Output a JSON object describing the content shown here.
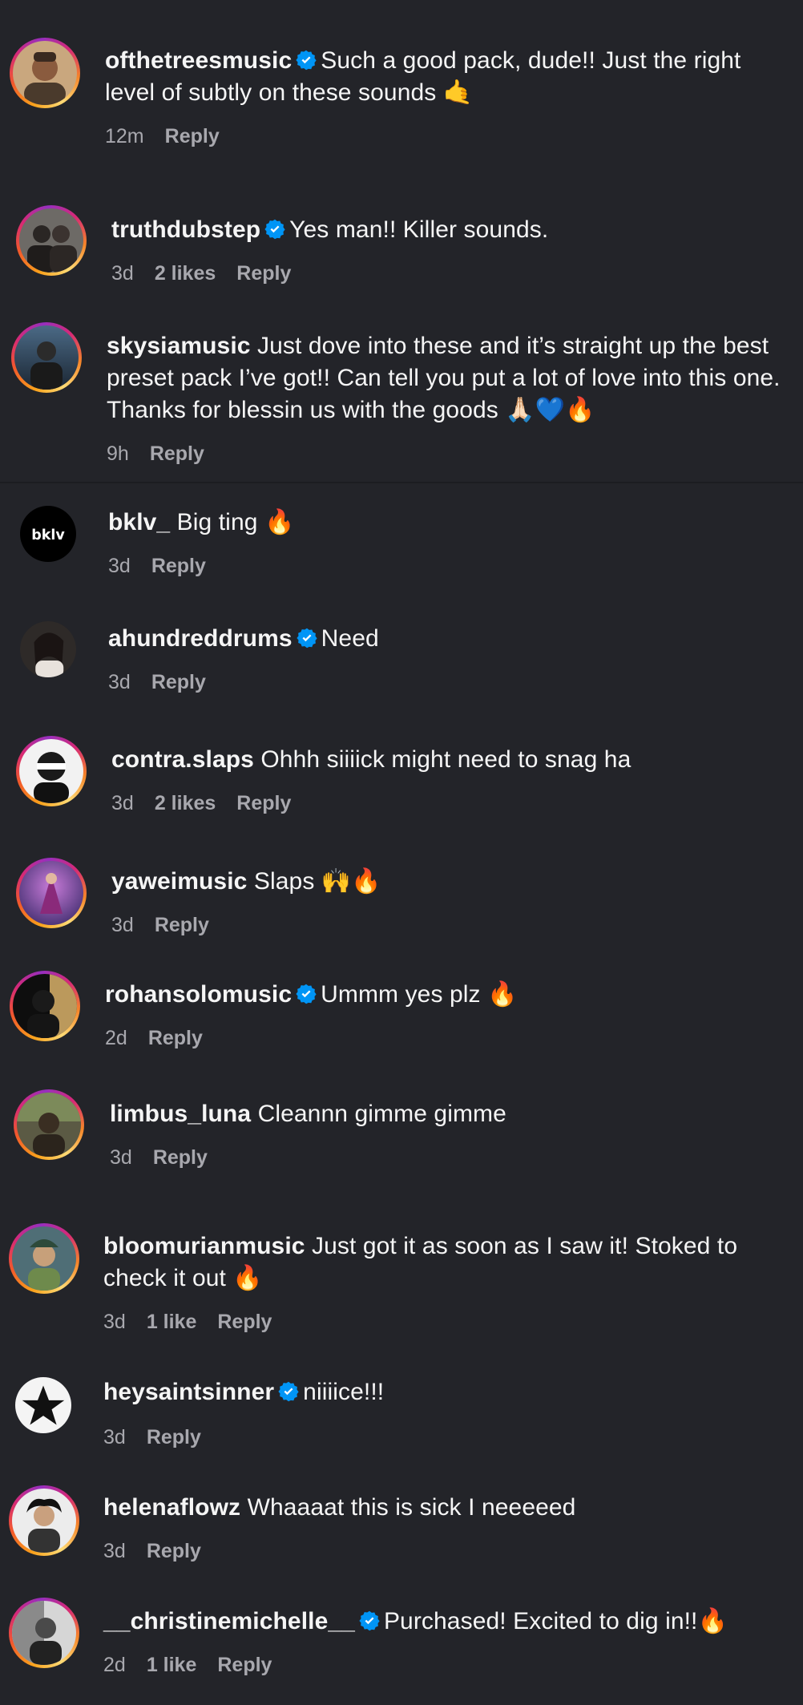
{
  "comments": [
    {
      "username": "ofthetreesmusic",
      "verified": true,
      "text": "Such a good pack, dude!! Just the right level of subtly on these sounds 🤙",
      "time": "12m",
      "likes": "",
      "reply": "Reply"
    },
    {
      "username": "truthdubstep",
      "verified": true,
      "text": "Yes man!! Killer sounds.",
      "time": "3d",
      "likes": "2 likes",
      "reply": "Reply"
    },
    {
      "username": "skysiamusic",
      "verified": false,
      "text": "Just dove into these and it’s straight up the best preset pack I’ve got!! Can tell you put a lot of love into this one. Thanks for blessin us with the goods 🙏🏻💙🔥",
      "time": "9h",
      "likes": "",
      "reply": "Reply"
    },
    {
      "username": "bklv_",
      "verified": false,
      "text": "Big ting 🔥",
      "time": "3d",
      "likes": "",
      "reply": "Reply"
    },
    {
      "username": "ahundreddrums",
      "verified": true,
      "text": "Need",
      "time": "3d",
      "likes": "",
      "reply": "Reply"
    },
    {
      "username": "contra.slaps",
      "verified": false,
      "text": "Ohhh siiiick might need to snag ha",
      "time": "3d",
      "likes": "2 likes",
      "reply": "Reply"
    },
    {
      "username": "yaweimusic",
      "verified": false,
      "text": "Slaps 🙌🔥",
      "time": "3d",
      "likes": "",
      "reply": "Reply"
    },
    {
      "username": "rohansolomusic",
      "verified": true,
      "text": "Ummm yes plz 🔥",
      "time": "2d",
      "likes": "",
      "reply": "Reply"
    },
    {
      "username": "limbus_luna",
      "verified": false,
      "text": "Cleannn gimme gimme",
      "time": "3d",
      "likes": "",
      "reply": "Reply"
    },
    {
      "username": "bloomurianmusic",
      "verified": false,
      "text": "Just got it as soon as I saw it! Stoked to check it out 🔥",
      "time": "3d",
      "likes": "1 like",
      "reply": "Reply"
    },
    {
      "username": "heysaintsinner",
      "verified": true,
      "text": "niiiice!!!",
      "time": "3d",
      "likes": "",
      "reply": "Reply"
    },
    {
      "username": "helenaflowz",
      "verified": false,
      "text": "Whaaaat this is sick I neeeeed",
      "time": "3d",
      "likes": "",
      "reply": "Reply"
    },
    {
      "username": "__christinemichelle__",
      "verified": true,
      "text": "Purchased! Excited to dig in!!🔥",
      "time": "2d",
      "likes": "1 like",
      "reply": "Reply"
    }
  ],
  "colors": {
    "background": "#232429",
    "verified_badge": "#0095f6",
    "meta_text": "#a8a8ae"
  },
  "icons": {
    "verified": "verified-badge-icon"
  }
}
